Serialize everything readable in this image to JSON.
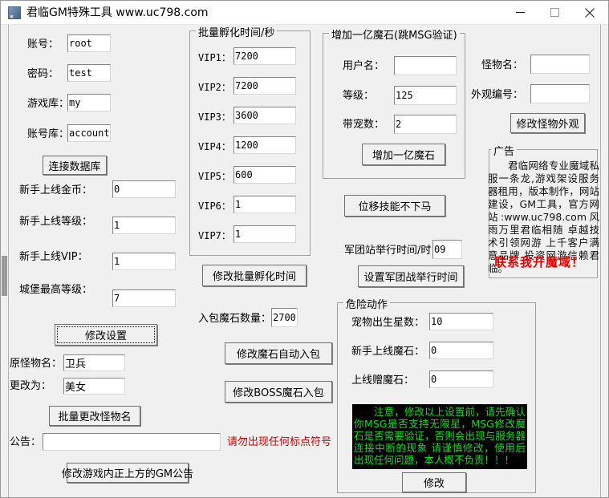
{
  "window": {
    "title": "君临GM特殊工具 www.uc798.com",
    "icon": "app-icon",
    "controls": {
      "minimize": "—",
      "maximize": "□",
      "close": "✕"
    }
  },
  "db_section": {
    "account_label": "账号：",
    "account_value": "root",
    "password_label": "密码：",
    "password_value": "test",
    "gamedb_label": "游戏库：",
    "gamedb_value": "my",
    "accountdb_label": "账号库：",
    "accountdb_value": "account",
    "connect_button": "连接数据库"
  },
  "newbie_section": {
    "gold_label": "新手上线金币：",
    "gold_value": "0",
    "level_label": "新手上线等级：",
    "level_value": "1",
    "vip_label": "新手上线VIP：",
    "vip_value": "1",
    "castle_label": "城堡最高等级：",
    "castle_value": "7",
    "save_button": "修改设置"
  },
  "monster_rename": {
    "origin_label": "原怪物名：",
    "origin_value": "卫兵",
    "newname_label": "更改为：",
    "newname_value": "美女",
    "button": "批量更改怪物名"
  },
  "notice": {
    "label": "公告：",
    "value": "",
    "hint": "请勿出现任何标点符号",
    "button": "修改游戏内正上方的GM公告"
  },
  "hatch_group": {
    "caption": "批量孵化时间/秒",
    "rows": [
      {
        "label": "VIP1：",
        "value": "7200"
      },
      {
        "label": "VIP2：",
        "value": "7200"
      },
      {
        "label": "VIP3：",
        "value": "3600"
      },
      {
        "label": "VIP4：",
        "value": "1200"
      },
      {
        "label": "VIP5：",
        "value": "600"
      },
      {
        "label": "VIP6：",
        "value": "1"
      },
      {
        "label": "VIP7：",
        "value": "1"
      }
    ],
    "button": "修改批量孵化时间"
  },
  "stone_bag": {
    "label": "入包魔石数量：",
    "value": "2700",
    "auto_button": "修改魔石自动入包",
    "boss_button": "修改BOSS魔石入包"
  },
  "add_stone_group": {
    "caption": "增加一亿魔石(跳MSG验证)",
    "user_label": "用户名：",
    "user_value": "",
    "level_label": "等级：",
    "level_value": "125",
    "pet_label": "带宠数：",
    "pet_value": "2",
    "button": "增加一亿魔石"
  },
  "skill_button": "位移技能不下马",
  "legion": {
    "label": "军团站举行时间/时",
    "value": "09",
    "button": "设置军团战举行时间"
  },
  "monster_look": {
    "name_label": "怪物名：",
    "name_value": "",
    "code_label": "外观编号：",
    "code_value": "",
    "button": "修改怪物外观"
  },
  "ad": {
    "caption": "广告",
    "text": "君临网络专业魔域私服一条龙,游戏架设服务器租用，版本制作，网站建设，GM工具，官方网站:www.uc798.com风雨万里君临相随 卓越技术引领网游 上千客户满意品牌 投资网游信赖君临。",
    "slogan": "联系我开魔域！",
    "slogan_color": "#e00000"
  },
  "danger_group": {
    "caption": "危险动作",
    "pet_star_label": "宠物出生星数：",
    "pet_star_value": "10",
    "newbie_stone_label": "新手上线魔石：",
    "newbie_stone_value": "0",
    "login_gift_label": "上线赠魔石：",
    "login_gift_value": "0",
    "warning": "注意，修改以上设置前，请先确认你MSG是否支持无限星，MSG修改魔石是否需要验证，否则会出现与服务器连接中断的现象 请谨慎修改，使用后出现任何问题，本人概不负责！！！",
    "warning_color": "#22d52b",
    "button": "修改"
  }
}
